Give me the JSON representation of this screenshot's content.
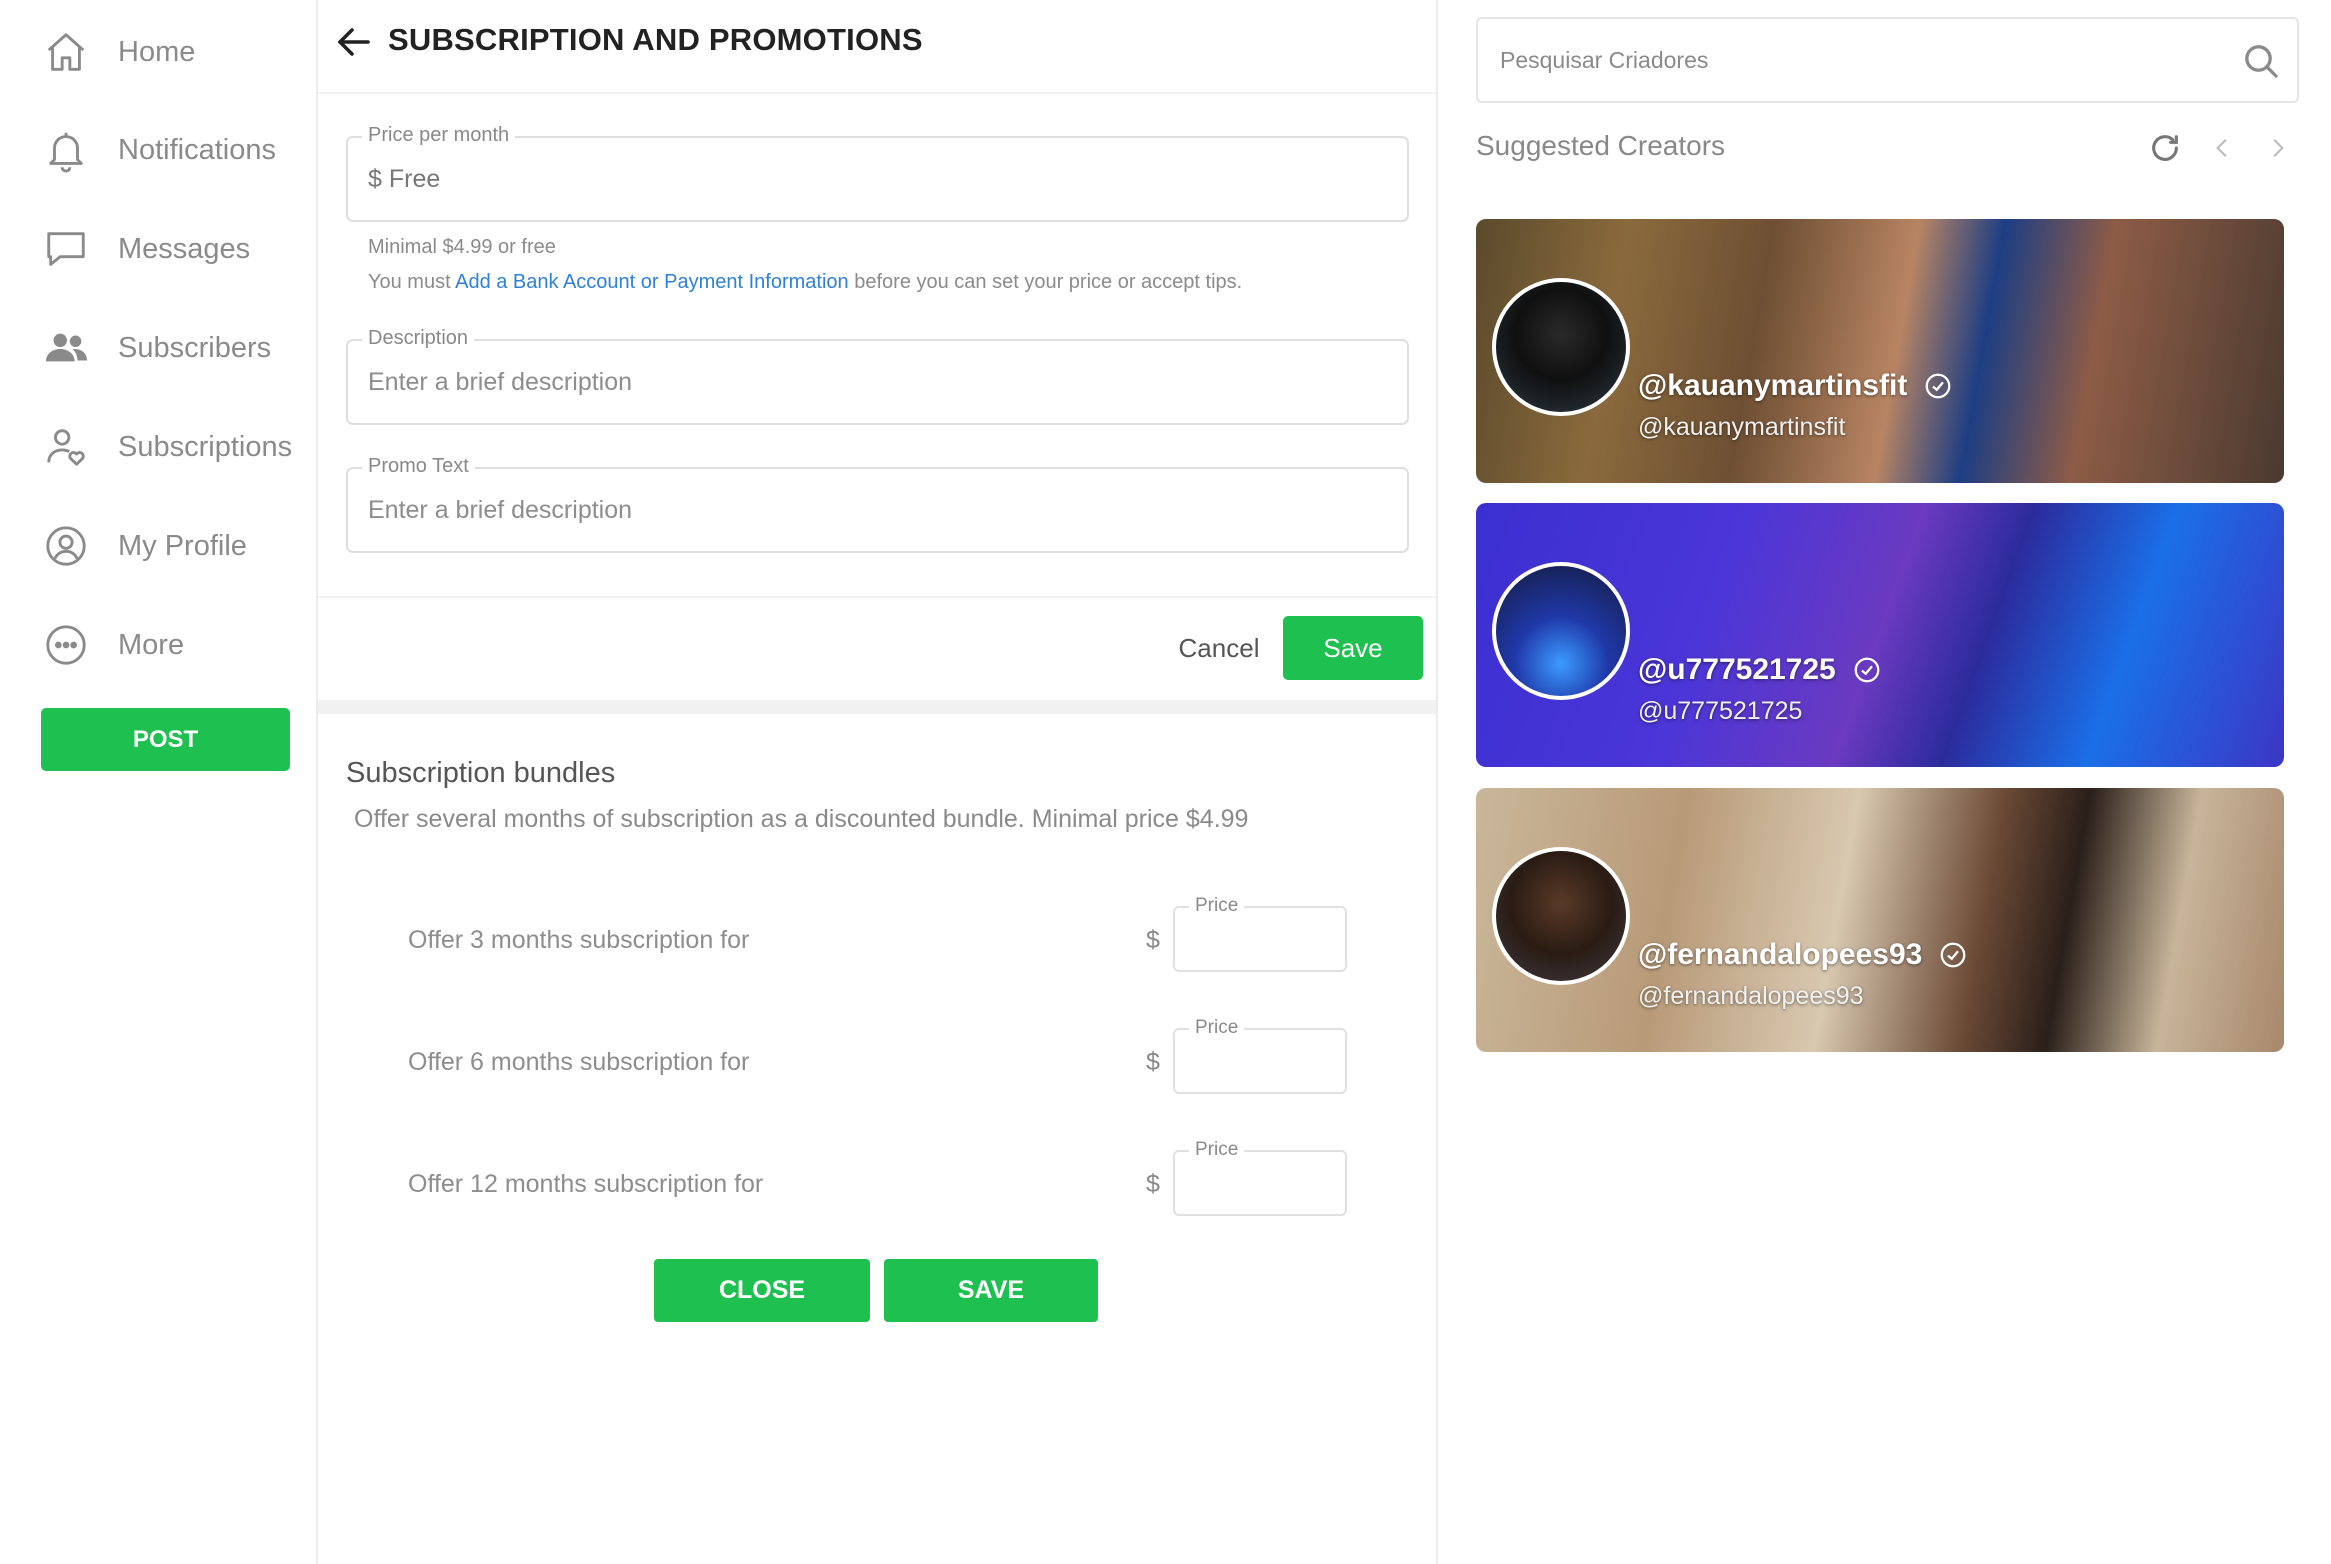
{
  "sidebar": {
    "items": [
      {
        "label": "Home",
        "icon": "home-icon"
      },
      {
        "label": "Notifications",
        "icon": "bell-icon"
      },
      {
        "label": "Messages",
        "icon": "message-icon"
      },
      {
        "label": "Subscribers",
        "icon": "users-icon"
      },
      {
        "label": "Subscriptions",
        "icon": "user-heart-icon"
      },
      {
        "label": "My Profile",
        "icon": "profile-icon"
      },
      {
        "label": "More",
        "icon": "more-icon"
      }
    ],
    "post_label": "POST"
  },
  "header": {
    "title": "SUBSCRIPTION AND PROMOTIONS"
  },
  "price": {
    "label": "Price per month",
    "value": "$ Free"
  },
  "hints": {
    "minimal": "Minimal $4.99 or free",
    "must_prefix": "You must",
    "link": "Add a Bank Account or Payment Information",
    "must_suffix": "before you can set your price or accept tips."
  },
  "description": {
    "label": "Description",
    "placeholder": "Enter a brief description"
  },
  "promo": {
    "label": "Promo Text",
    "placeholder": "Enter a brief description"
  },
  "actions": {
    "cancel": "Cancel",
    "save": "Save"
  },
  "bundles": {
    "title": "Subscription bundles",
    "desc": "Offer several months of subscription as a discounted bundle. Minimal price $4.99",
    "currency": "$",
    "price_label": "Price",
    "offers": [
      {
        "text": "Offer 3 months subscription for"
      },
      {
        "text": "Offer 6 months subscription for"
      },
      {
        "text": "Offer 12 months subscription for"
      }
    ],
    "close": "CLOSE",
    "save": "SAVE"
  },
  "right": {
    "search_placeholder": "Pesquisar Criadores",
    "suggested_title": "Suggested Creators",
    "creators": [
      {
        "name": "@kauanymartinsfit",
        "handle": "@kauanymartinsfit"
      },
      {
        "name": "@u777521725",
        "handle": "@u777521725"
      },
      {
        "name": "@fernandalopees93",
        "handle": "@fernandalopees93"
      }
    ]
  },
  "colors": {
    "accent": "#1ec14f",
    "link": "#2f80d8"
  }
}
